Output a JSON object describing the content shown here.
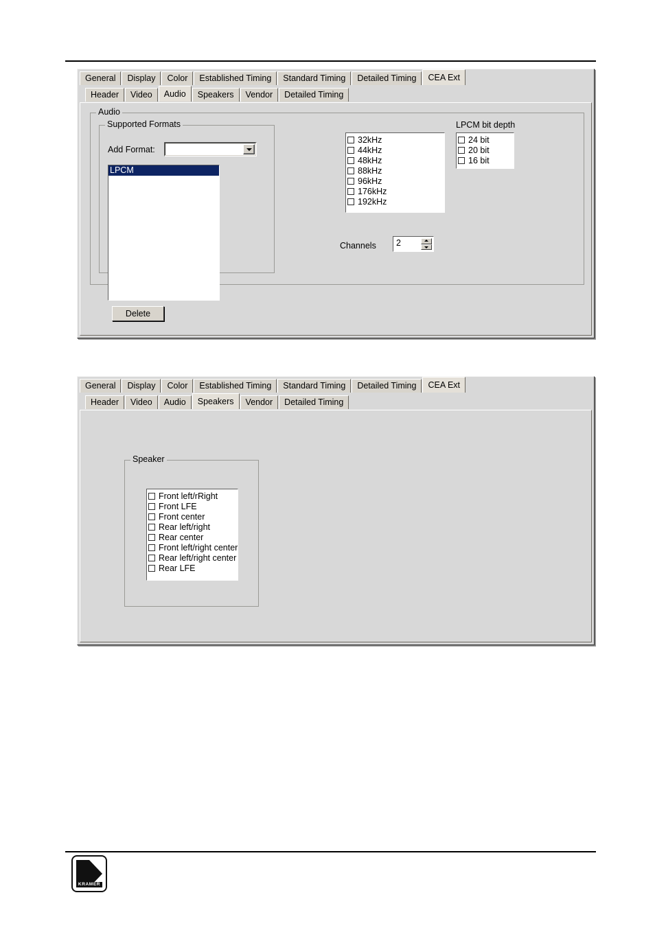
{
  "page": {
    "rules": {
      "top_label": "header-rule",
      "bottom_label": "footer-rule"
    },
    "logo": {
      "wordmark": "KRAMER",
      "letter": "K"
    }
  },
  "outer_tabs": [
    {
      "label": "General",
      "selected": false
    },
    {
      "label": "Display",
      "selected": false
    },
    {
      "label": "Color",
      "selected": false
    },
    {
      "label": "Established Timing",
      "selected": false
    },
    {
      "label": "Standard Timing",
      "selected": false
    },
    {
      "label": "Detailed Timing",
      "selected": false
    },
    {
      "label": "CEA Ext",
      "selected": true
    }
  ],
  "audio_panel": {
    "inner_tabs": [
      {
        "label": "Header",
        "selected": false
      },
      {
        "label": "Video",
        "selected": false
      },
      {
        "label": "Audio",
        "selected": true
      },
      {
        "label": "Speakers",
        "selected": false
      },
      {
        "label": "Vendor",
        "selected": false
      },
      {
        "label": "Detailed Timing",
        "selected": false
      }
    ],
    "audio_group_title": "Audio",
    "supported_formats_group_title": "Supported Formats",
    "add_format_label": "Add Format:",
    "add_format_value": "",
    "format_list": [
      {
        "label": "LPCM",
        "selected": true
      }
    ],
    "delete_button_label": "Delete",
    "sample_rates": [
      {
        "label": "32kHz",
        "checked": false
      },
      {
        "label": "44kHz",
        "checked": false
      },
      {
        "label": "48kHz",
        "checked": false
      },
      {
        "label": "88kHz",
        "checked": false
      },
      {
        "label": "96kHz",
        "checked": false
      },
      {
        "label": "176kHz",
        "checked": false
      },
      {
        "label": "192kHz",
        "checked": false
      }
    ],
    "bit_depth_label": "LPCM bit depth",
    "bit_depths": [
      {
        "label": "24 bit",
        "checked": false
      },
      {
        "label": "20 bit",
        "checked": false
      },
      {
        "label": "16 bit",
        "checked": false
      }
    ],
    "channels_label": "Channels",
    "channels_value": "2"
  },
  "speakers_panel": {
    "inner_tabs": [
      {
        "label": "Header",
        "selected": false
      },
      {
        "label": "Video",
        "selected": false
      },
      {
        "label": "Audio",
        "selected": false
      },
      {
        "label": "Speakers",
        "selected": true
      },
      {
        "label": "Vendor",
        "selected": false
      },
      {
        "label": "Detailed Timing",
        "selected": false
      }
    ],
    "speaker_group_title": "Speaker",
    "speakers": [
      {
        "label": "Front left/rRight",
        "checked": false
      },
      {
        "label": "Front LFE",
        "checked": false
      },
      {
        "label": "Front center",
        "checked": false
      },
      {
        "label": "Rear left/right",
        "checked": false
      },
      {
        "label": "Rear center",
        "checked": false
      },
      {
        "label": "Front left/right center",
        "checked": false
      },
      {
        "label": "Rear left/right center",
        "checked": false
      },
      {
        "label": "Rear LFE",
        "checked": false
      }
    ]
  },
  "colors": {
    "dialog_face": "#d8d8d8",
    "tab_face": "#d8d4cc",
    "selection": "#0d2463",
    "field_bg": "#ffffff",
    "rule": "#000000"
  }
}
